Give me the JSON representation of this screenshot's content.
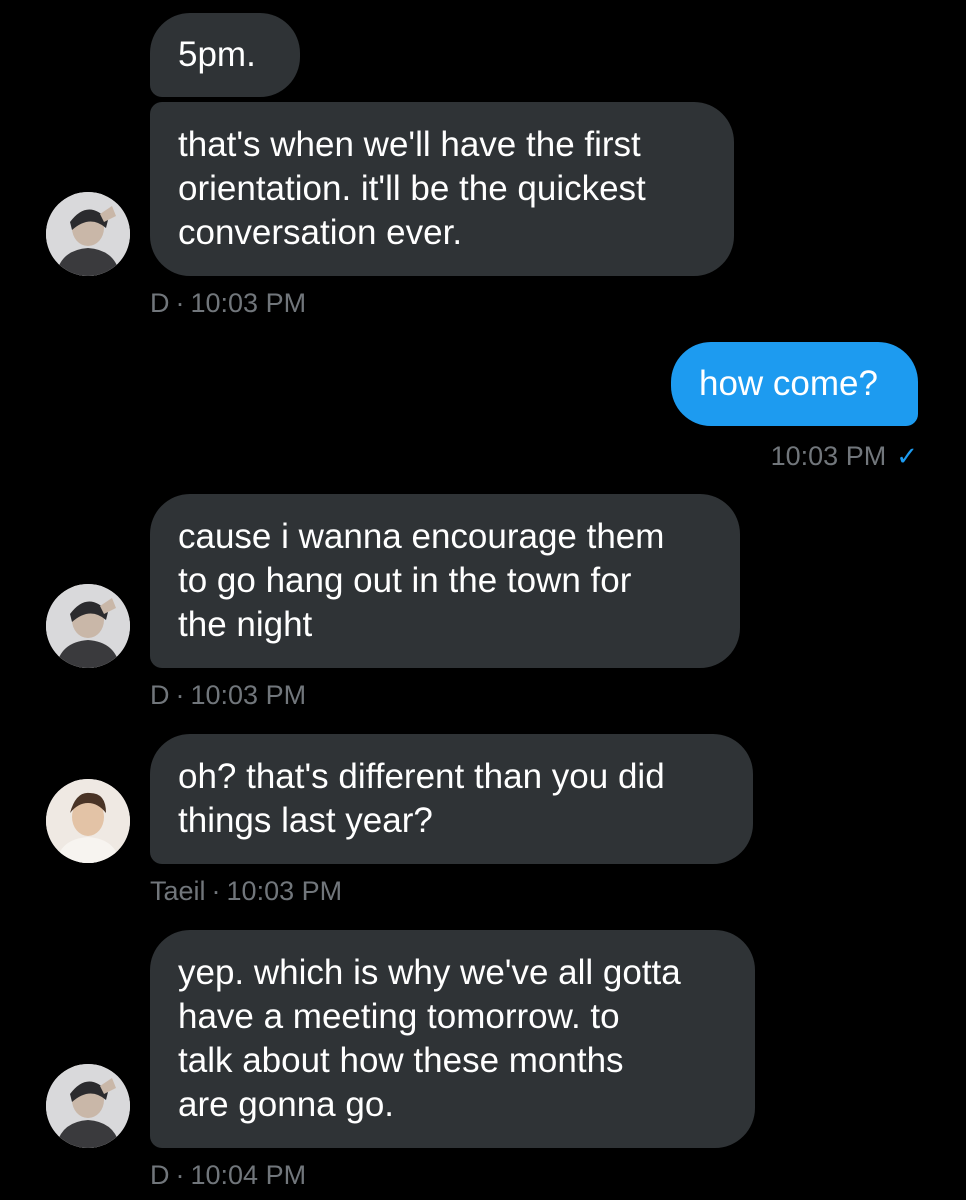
{
  "messages": [
    {
      "lines": [
        "5pm."
      ]
    },
    {
      "lines": [
        "that's when we'll have the first",
        "orientation. it'll be the quickest",
        "conversation ever."
      ],
      "sender": "D",
      "time": "10:03 PM"
    },
    {
      "lines": [
        "how come?"
      ],
      "time": "10:03 PM",
      "status_icon": "check-icon"
    },
    {
      "lines": [
        "cause i wanna encourage them",
        "to go hang out in the town for",
        "the night"
      ],
      "sender": "D",
      "time": "10:03 PM"
    },
    {
      "lines": [
        "oh? that's different than you did",
        "things last year?"
      ],
      "sender": "Taeil",
      "time": "10:03 PM"
    },
    {
      "lines": [
        "yep. which is why we've all gotta",
        "have a meeting tomorrow. to",
        "talk about how these months",
        "are gonna go."
      ],
      "sender": "D",
      "time": "10:04 PM"
    }
  ],
  "meta_separator": "·",
  "check_glyph": "✓",
  "colors": {
    "background": "#000000",
    "incoming_bubble": "#2f3336",
    "outgoing_bubble": "#1d9bf0",
    "meta_text": "#71767b"
  }
}
